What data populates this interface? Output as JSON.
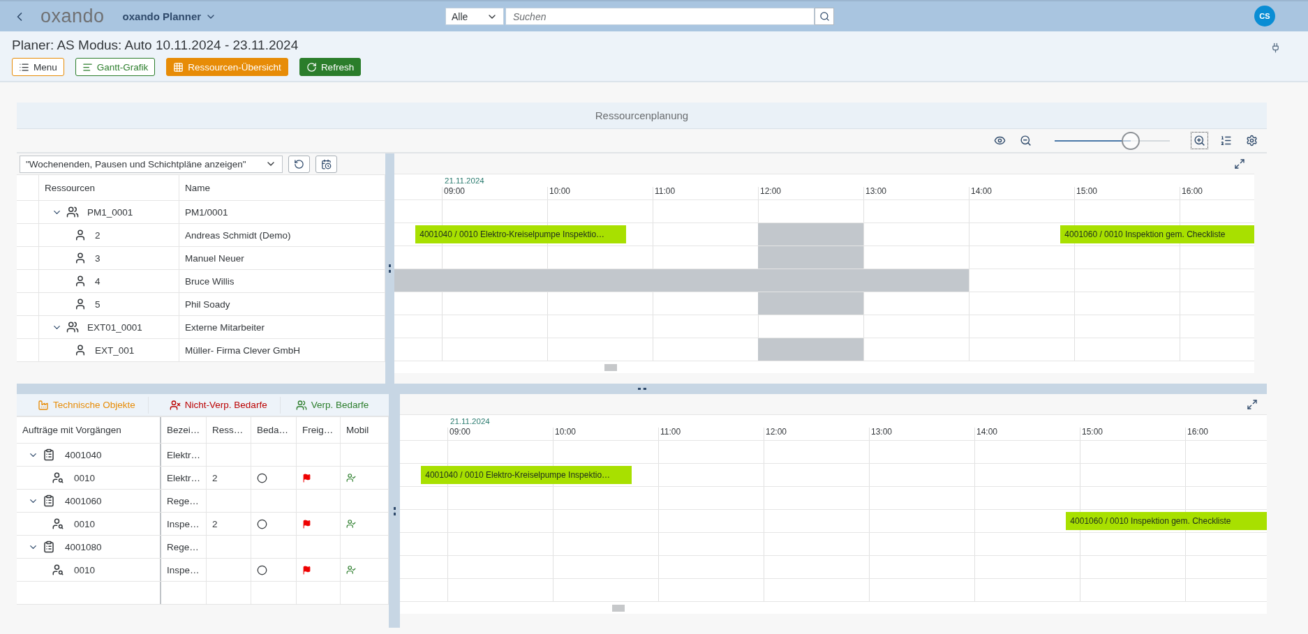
{
  "shell": {
    "logo": "oxando",
    "app_title": "oxando Planner",
    "search": {
      "scope": "Alle",
      "placeholder": "Suchen"
    },
    "avatar": "CS"
  },
  "page": {
    "title": "Planer: AS Modus: Auto 10.11.2024 - 23.11.2024",
    "buttons": [
      {
        "label": "Menu",
        "kind": "menu",
        "color": "#e78c07"
      },
      {
        "label": "Gantt-Grafik",
        "kind": "gantt",
        "color": "#2b7d2b"
      },
      {
        "label": "Ressourcen-Übersicht",
        "kind": "overview",
        "color": "#e78c07"
      },
      {
        "label": "Refresh",
        "kind": "refresh",
        "color": "#2b7d2b"
      }
    ]
  },
  "panel": {
    "title": "Ressourcenplanung",
    "zoom": {
      "level": 0.66
    },
    "filter": {
      "value": "\"Wochenenden, Pausen und Schichtpläne anzeigen\""
    },
    "resources": {
      "columns": [
        "Ressourcen",
        "Name"
      ],
      "timeline": {
        "date": "21.11.2024",
        "hours": [
          "09:00",
          "10:00",
          "11:00",
          "12:00",
          "13:00",
          "14:00",
          "15:00",
          "16:00"
        ]
      },
      "rows": [
        {
          "id": "PM1_0001",
          "name": "PM1/0001",
          "expanded": true,
          "children": [
            {
              "id": "2",
              "name": "Andreas Schmidt (Demo)",
              "bars": [
                {
                  "kind": "task",
                  "label": "4001040 / 0010 Elektro-Kreiselpumpe Inspektio…"
                },
                {
                  "kind": "break"
                },
                {
                  "kind": "task",
                  "label": "4001060 / 0010 Inspektion gem. Checkliste"
                }
              ]
            },
            {
              "id": "3",
              "name": "Manuel Neuer",
              "bars": [
                {
                  "kind": "break"
                }
              ]
            },
            {
              "id": "4",
              "name": "Bruce Willis",
              "bars": [
                {
                  "kind": "break"
                }
              ]
            },
            {
              "id": "5",
              "name": "Phil Soady",
              "bars": [
                {
                  "kind": "break"
                }
              ]
            }
          ]
        },
        {
          "id": "EXT01_0001",
          "name": "Externe Mitarbeiter",
          "expanded": true,
          "children": [
            {
              "id": "EXT_001",
              "name": "Müller- Firma Clever GmbH",
              "bars": [
                {
                  "kind": "break"
                }
              ]
            }
          ]
        }
      ]
    },
    "demand_tabs": [
      {
        "label": "Technische Objekte",
        "kind": "objects",
        "color": "#e78c07"
      },
      {
        "label": "Nicht-Verp. Bedarfe",
        "kind": "unassigned",
        "color": "#bb0000"
      },
      {
        "label": "Verp. Bedarfe",
        "kind": "assigned",
        "color": "#2b7d2b"
      }
    ],
    "orders": {
      "columns": [
        "Aufträge mit Vorgängen",
        "Bezei…",
        "Ress…",
        "Beda…",
        "Freig…",
        "Mobil"
      ],
      "timeline": {
        "date": "21.11.2024",
        "hours": [
          "09:00",
          "10:00",
          "11:00",
          "12:00",
          "13:00",
          "14:00",
          "15:00",
          "16:00"
        ]
      },
      "rows": [
        {
          "id": "4001040",
          "designation": "Elektr…",
          "expanded": true,
          "children": [
            {
              "id": "0010",
              "designation": "Elektr…",
              "resource": "2",
              "demand_open": true,
              "released": true,
              "mobile": true,
              "bars": [
                {
                  "kind": "task",
                  "label": "4001040 / 0010 Elektro-Kreiselpumpe Inspektio…"
                }
              ]
            }
          ]
        },
        {
          "id": "4001060",
          "designation": "Rege…",
          "expanded": true,
          "children": [
            {
              "id": "0010",
              "designation": "Inspe…",
              "resource": "2",
              "demand_open": true,
              "released": true,
              "mobile": true,
              "bars": [
                {
                  "kind": "task",
                  "label": "4001060 / 0010 Inspektion gem. Checkliste"
                }
              ]
            }
          ]
        },
        {
          "id": "4001080",
          "designation": "Rege…",
          "expanded": true,
          "children": [
            {
              "id": "0010",
              "designation": "Inspe…",
              "demand_open": true,
              "released": true,
              "mobile": true
            }
          ]
        }
      ]
    }
  }
}
